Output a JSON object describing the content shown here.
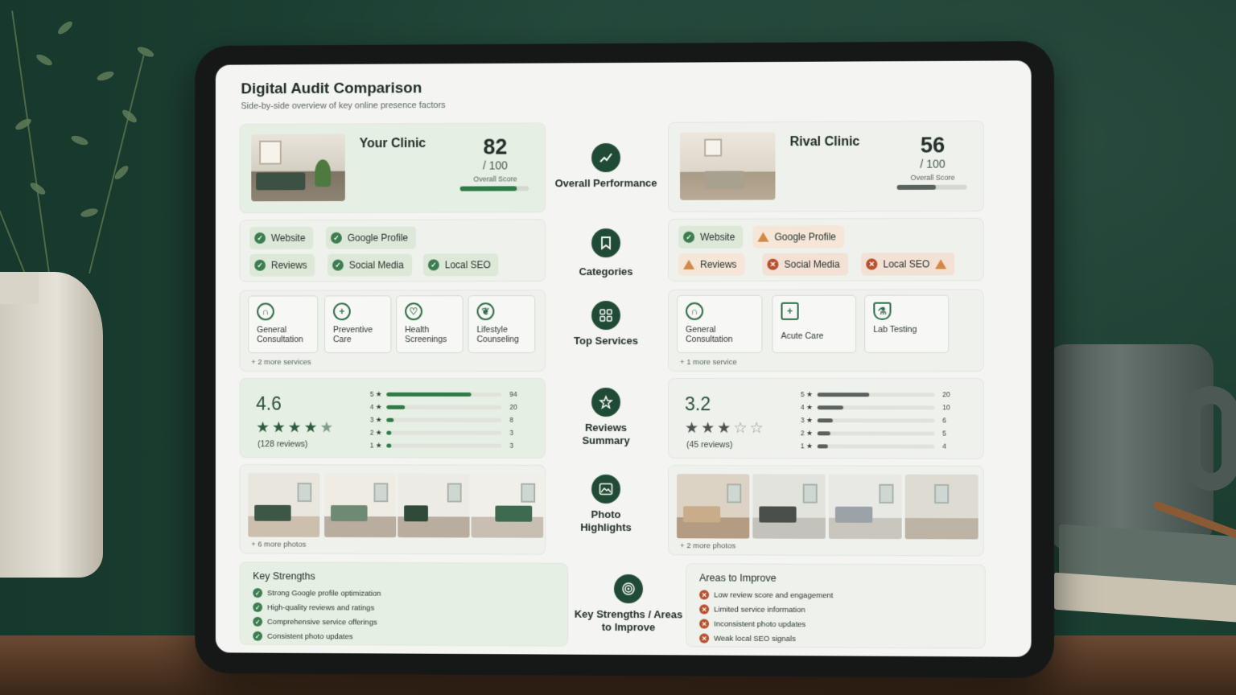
{
  "header": {
    "title": "Digital Audit Comparison",
    "subtitle": "Side-by-side overview of key online presence factors"
  },
  "colors": {
    "accent": "#2f7a47",
    "dark": "#1f4a35",
    "rival_bar": "#5b625e",
    "warn": "#d08a45",
    "bad": "#b4502e"
  },
  "sections": [
    {
      "label": "Overall Performance",
      "icon": "chart-icon"
    },
    {
      "label": "Categories",
      "icon": "bookmark-icon"
    },
    {
      "label": "Top Services",
      "icon": "grid-icon"
    },
    {
      "label": "Reviews Summary",
      "icon": "star-icon"
    },
    {
      "label": "Photo Highlights",
      "icon": "image-icon"
    },
    {
      "label": "Key Strengths / Areas to Improve",
      "icon": "target-icon"
    }
  ],
  "your_clinic": {
    "name": "Your Clinic",
    "score": "82",
    "score_den": "/ 100",
    "score_label": "Overall Score",
    "score_fraction": 0.82,
    "categories": [
      {
        "label": "Website",
        "status": "ok"
      },
      {
        "label": "Google Profile",
        "status": "ok"
      },
      {
        "label": "Reviews",
        "status": "ok"
      },
      {
        "label": "Social Media",
        "status": "ok"
      },
      {
        "label": "Local SEO",
        "status": "ok"
      }
    ],
    "services": [
      "General Consultation",
      "Preventive Care",
      "Health Screenings",
      "Lifestyle Counseling"
    ],
    "services_more": "+ 2 more services",
    "rating": "4.6",
    "stars": 4.5,
    "reviews_count": "(128 reviews)",
    "rating_bars": [
      {
        "star": "5 ★",
        "count": "94",
        "value": 94
      },
      {
        "star": "4 ★",
        "count": "20",
        "value": 20
      },
      {
        "star": "3 ★",
        "count": "8",
        "value": 8
      },
      {
        "star": "2 ★",
        "count": "3",
        "value": 3
      },
      {
        "star": "1 ★",
        "count": "3",
        "value": 3
      }
    ],
    "photos_more": "+ 6 more photos",
    "list_title": "Key Strengths",
    "list": [
      "Strong Google profile optimization",
      "High-quality reviews and ratings",
      "Comprehensive service offerings",
      "Consistent photo updates"
    ]
  },
  "rival_clinic": {
    "name": "Rival Clinic",
    "score": "56",
    "score_den": "/ 100",
    "score_label": "Overall Score",
    "score_fraction": 0.56,
    "categories": [
      {
        "label": "Website",
        "status": "ok"
      },
      {
        "label": "Google Profile",
        "status": "warn"
      },
      {
        "label": "Reviews",
        "status": "warn"
      },
      {
        "label": "Social Media",
        "status": "bad"
      },
      {
        "label": "Local SEO",
        "status": "bad"
      }
    ],
    "services": [
      "General Consultation",
      "Acute Care",
      "Lab Testing"
    ],
    "services_more": "+ 1 more service",
    "rating": "3.2",
    "stars": 3,
    "reviews_count": "(45 reviews)",
    "rating_bars": [
      {
        "star": "5 ★",
        "count": "20",
        "value": 20
      },
      {
        "star": "4 ★",
        "count": "10",
        "value": 10
      },
      {
        "star": "3 ★",
        "count": "6",
        "value": 6
      },
      {
        "star": "2 ★",
        "count": "5",
        "value": 5
      },
      {
        "star": "1 ★",
        "count": "4",
        "value": 4
      }
    ],
    "photos_more": "+ 2 more photos",
    "list_title": "Areas to Improve",
    "list": [
      "Low review score and engagement",
      "Limited service information",
      "Inconsistent photo updates",
      "Weak local SEO signals"
    ]
  }
}
